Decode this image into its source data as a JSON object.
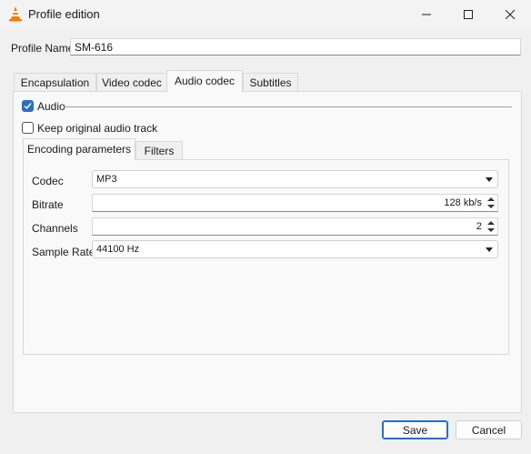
{
  "window": {
    "title": "Profile edition",
    "icon": "vlc-cone-icon"
  },
  "profile": {
    "label": "Profile Name",
    "value": "SM-616"
  },
  "tabs": [
    {
      "label": "Encapsulation",
      "active": false
    },
    {
      "label": "Video codec",
      "active": false
    },
    {
      "label": "Audio codec",
      "active": true
    },
    {
      "label": "Subtitles",
      "active": false
    }
  ],
  "audio": {
    "enable_label": "Audio",
    "enable_checked": true,
    "keep_label": "Keep original audio track",
    "keep_checked": false
  },
  "inner_tabs": [
    {
      "label": "Encoding parameters",
      "active": true
    },
    {
      "label": "Filters",
      "active": false
    }
  ],
  "params": {
    "codec_label": "Codec",
    "codec_value": "MP3",
    "bitrate_label": "Bitrate",
    "bitrate_value": "128 kb/s",
    "channels_label": "Channels",
    "channels_value": "2",
    "samplerate_label": "Sample Rate",
    "samplerate_value": "44100 Hz"
  },
  "buttons": {
    "save": "Save",
    "cancel": "Cancel"
  },
  "colors": {
    "accent": "#2e6ebf",
    "vlc_orange": "#f07f00"
  }
}
